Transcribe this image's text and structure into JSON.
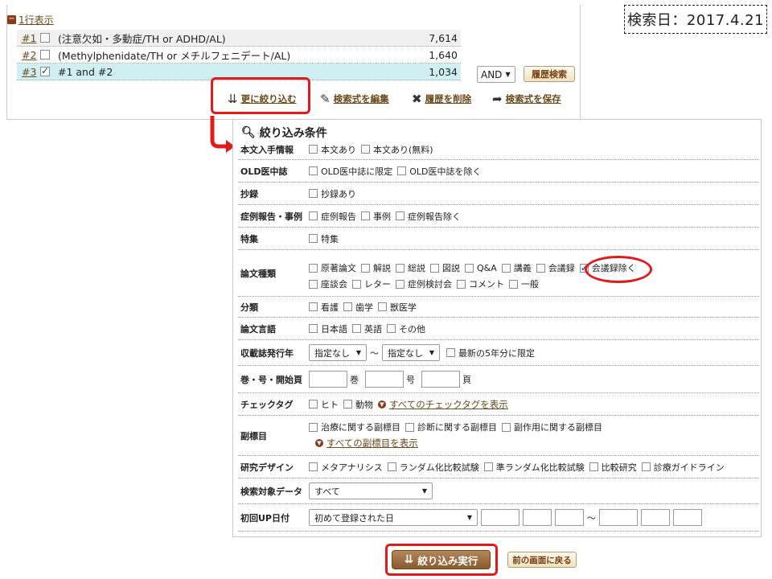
{
  "history": {
    "toggle_label": "1行表示",
    "rows": [
      {
        "id": "#1",
        "query": "(注意欠如・多動症/TH or ADHD/AL)",
        "count": "7,614",
        "checked": false
      },
      {
        "id": "#2",
        "query": "(Methylphenidate/TH or メチルフェニデート/AL)",
        "count": "1,640",
        "checked": false
      },
      {
        "id": "#3",
        "query": "#1 and #2",
        "count": "1,034",
        "checked": true
      }
    ],
    "operator": "AND",
    "history_search_label": "履歴検索",
    "actions": {
      "narrow": "更に絞り込む",
      "edit": "検索式を編集",
      "delete": "履歴を削除",
      "save": "検索式を保存"
    }
  },
  "search_date": "検索日：2017.4.21",
  "filter": {
    "title": "絞り込み条件",
    "fulltext": {
      "label": "本文入手情報",
      "options": [
        "本文あり",
        "本文あり(無料)"
      ]
    },
    "old": {
      "label": "OLD医中誌",
      "options": [
        "OLD医中誌に限定",
        "OLD医中誌を除く"
      ]
    },
    "abstract": {
      "label": "抄録",
      "options": [
        "抄録あり"
      ]
    },
    "case_report": {
      "label": "症例報告・事例",
      "options": [
        "症例報告",
        "事例",
        "症例報告除く"
      ]
    },
    "special": {
      "label": "特集",
      "options": [
        "特集"
      ]
    },
    "article_type": {
      "label": "論文種類",
      "options_line1": [
        "原著論文",
        "解説",
        "総説",
        "図説",
        "Q&A",
        "講義",
        "会議録",
        "会議録除く"
      ],
      "options_line2": [
        "座談会",
        "レター",
        "症例検討会",
        "コメント",
        "一般"
      ],
      "checked": "会議録除く"
    },
    "category": {
      "label": "分類",
      "options": [
        "看護",
        "歯学",
        "獣医学"
      ]
    },
    "language": {
      "label": "論文言語",
      "options": [
        "日本語",
        "英語",
        "その他"
      ]
    },
    "year": {
      "label": "収載誌発行年",
      "from": "指定なし",
      "to": "指定なし",
      "tilde": "〜",
      "recent_label": "最新の5年分に限定"
    },
    "volume": {
      "label": "巻・号・開始頁",
      "vol_unit": "巻",
      "issue_unit": "号",
      "page_unit": "頁"
    },
    "checktag": {
      "label": "チェックタグ",
      "options": [
        "ヒト",
        "動物"
      ],
      "show_all": "すべてのチェックタグを表示"
    },
    "subheading": {
      "label": "副標目",
      "options": [
        "治療に関する副標目",
        "診断に関する副標目",
        "副作用に関する副標目"
      ],
      "show_all": "すべての副標目を表示"
    },
    "design": {
      "label": "研究デザイン",
      "options": [
        "メタアナリシス",
        "ランダム化比較試験",
        "準ランダム化比較試験",
        "比較研究",
        "診療ガイドライン"
      ]
    },
    "target": {
      "label": "検索対象データ",
      "value": "すべて"
    },
    "first_up": {
      "label": "初回UP日付",
      "value": "初めて登録された日",
      "tilde": "〜"
    }
  },
  "buttons": {
    "execute": "絞り込み実行",
    "back": "前の画面に戻る"
  },
  "colors": {
    "highlight": "#e01b1b",
    "link": "#6b4a1b",
    "selected_row": "#cfeff2"
  }
}
